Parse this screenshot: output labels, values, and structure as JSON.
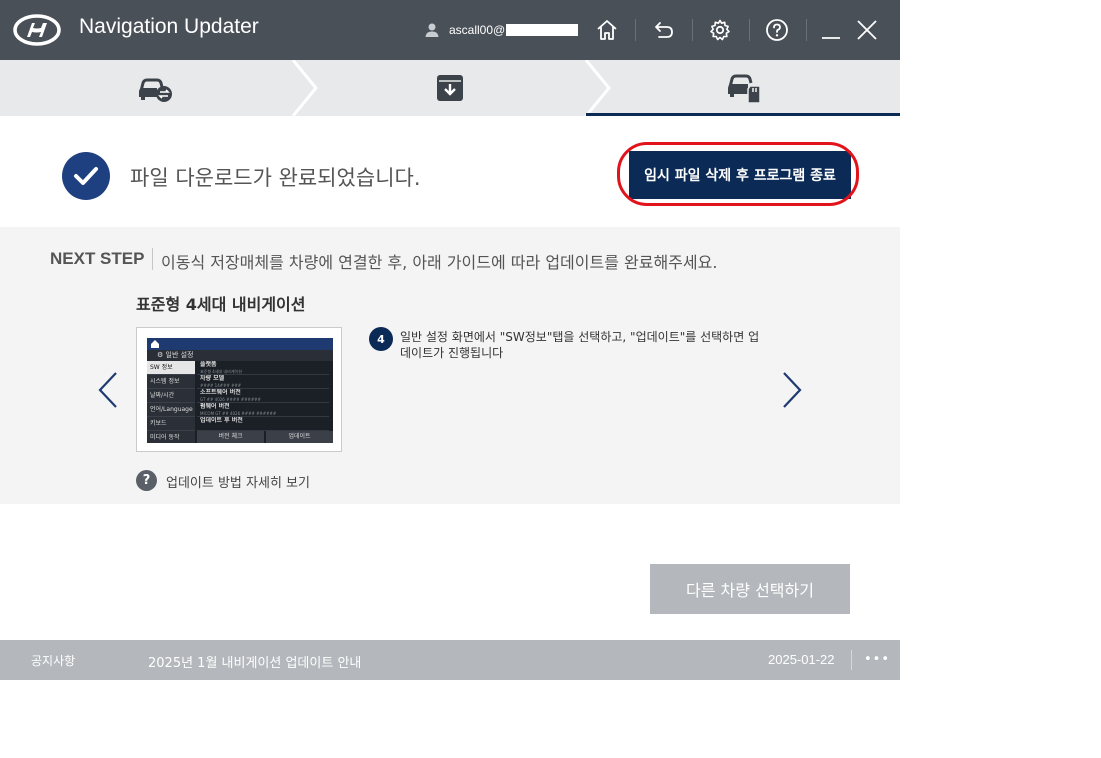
{
  "app": {
    "title": "Navigation Updater",
    "user": "ascall00@"
  },
  "titlebar": {
    "icons": [
      "user-icon",
      "home-icon",
      "back-icon",
      "gear-icon",
      "help-icon",
      "minimize-icon",
      "close-icon"
    ]
  },
  "steps": [
    {
      "name": "vehicle-select",
      "icon": "car-swap-icon"
    },
    {
      "name": "download",
      "icon": "download-box-icon"
    },
    {
      "name": "install",
      "icon": "car-sdcard-icon",
      "active": true
    }
  ],
  "completion": {
    "message": "파일 다운로드가 완료되었습니다.",
    "exit_button": "임시 파일 삭제 후 프로그램 종료"
  },
  "next_step": {
    "label": "NEXT STEP",
    "text": "이동식 저장매체를 차량에 연결한 후, 아래 가이드에 따라 업데이트를 완료해주세요."
  },
  "guide": {
    "title": "표준형 4세대 내비게이션",
    "step_number": "4",
    "description": "일반 설정 화면에서 \"SW정보\"탭을 선택하고, \"업데이트\"를 선택하면 업데이트가 진행됩니다",
    "help_link": "업데이트 방법 자세히 보기",
    "screen": {
      "header": "일반 설정",
      "sidebar": [
        "SW 정보",
        "시스템 정보",
        "날짜/시간",
        "언어/Language",
        "키보드",
        "미디어 동작"
      ],
      "items": [
        {
          "title": "플랫폼",
          "sub": "표준형 4세대 내비게이션"
        },
        {
          "title": "차량 모델",
          "sub": "#### 14### ###"
        },
        {
          "title": "소프트웨어 버전",
          "sub": "GT ## 4026 #### ######"
        },
        {
          "title": "펌웨어 버전",
          "sub": "MICOM GT ## 4026 #### ######"
        },
        {
          "title": "업데이트 후 버전",
          "sub": ""
        }
      ],
      "buttons": [
        "버전 체크",
        "업데이트"
      ]
    }
  },
  "other_vehicle_button": "다른 차량 선택하기",
  "notice": {
    "label": "공지사항",
    "title": "2025년 1월 내비게이션 업데이트 안내",
    "date": "2025-01-22",
    "more": "•••"
  },
  "colors": {
    "titlebar": "#4a5058",
    "accent": "#0b2a55",
    "check": "#1e4080",
    "highlight": "#e2141b",
    "disabled_button": "#b4b8bc"
  }
}
